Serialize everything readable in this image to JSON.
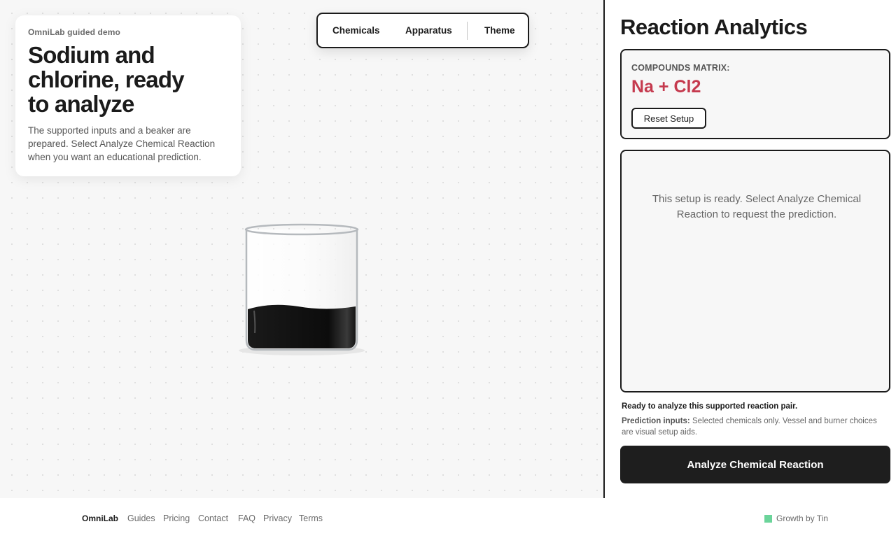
{
  "intro": {
    "eyebrow": "OmniLab guided demo",
    "headline": "Sodium and chlorine, ready to analyze",
    "description": "The supported inputs and a beaker are prepared. Select Analyze Chemical Reaction when you want an educational prediction."
  },
  "nav": {
    "chemicals": "Chemicals",
    "apparatus": "Apparatus",
    "theme": "Theme"
  },
  "beaker": {
    "liquid_color": "#111111"
  },
  "panel": {
    "title": "Reaction Analytics",
    "matrix_label": "COMPOUNDS MATRIX:",
    "formula": "Na + Cl2",
    "reset_label": "Reset Setup",
    "result_message": "This setup is ready. Select Analyze Chemical Reaction to request the prediction.",
    "status": "Ready to analyze this supported reaction pair.",
    "inputs_label": "Prediction inputs:",
    "inputs_text": "Selected chemicals only. Vessel and burner choices are visual setup aids.",
    "analyze_label": "Analyze Chemical Reaction"
  },
  "footer": {
    "brand": "OmniLab",
    "links": [
      "Guides",
      "Pricing",
      "Contact",
      "FAQ",
      "Privacy",
      "Terms"
    ],
    "growth": "Growth by Tin"
  },
  "colors": {
    "accent_formula": "#c53a4e",
    "dark": "#1b1b1b",
    "growth_dot": "#6bd49a"
  }
}
